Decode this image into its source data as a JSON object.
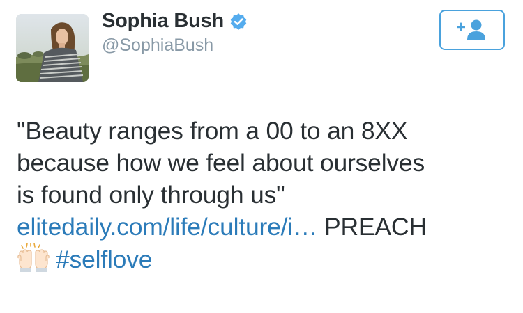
{
  "user": {
    "display_name": "Sophia Bush",
    "handle": "@SophiaBush",
    "verified": true,
    "verified_icon": "verified-badge-icon"
  },
  "follow_button": {
    "icon": "add-user-icon",
    "color": "#4aa2dd"
  },
  "tweet": {
    "line1": "\"Beauty ranges from a 00 to an 8XX",
    "line2": "because how we feel about ourselves",
    "line3": "is found only through us\"",
    "link_text": "elitedaily.com/life/culture/i…",
    "after_link": "PREACH",
    "emoji": "raised-hands-icon",
    "hashtag": "#selflove"
  },
  "colors": {
    "text": "#292f33",
    "muted": "#8899a6",
    "link": "#2b7bb9",
    "verified": "#55acee"
  }
}
